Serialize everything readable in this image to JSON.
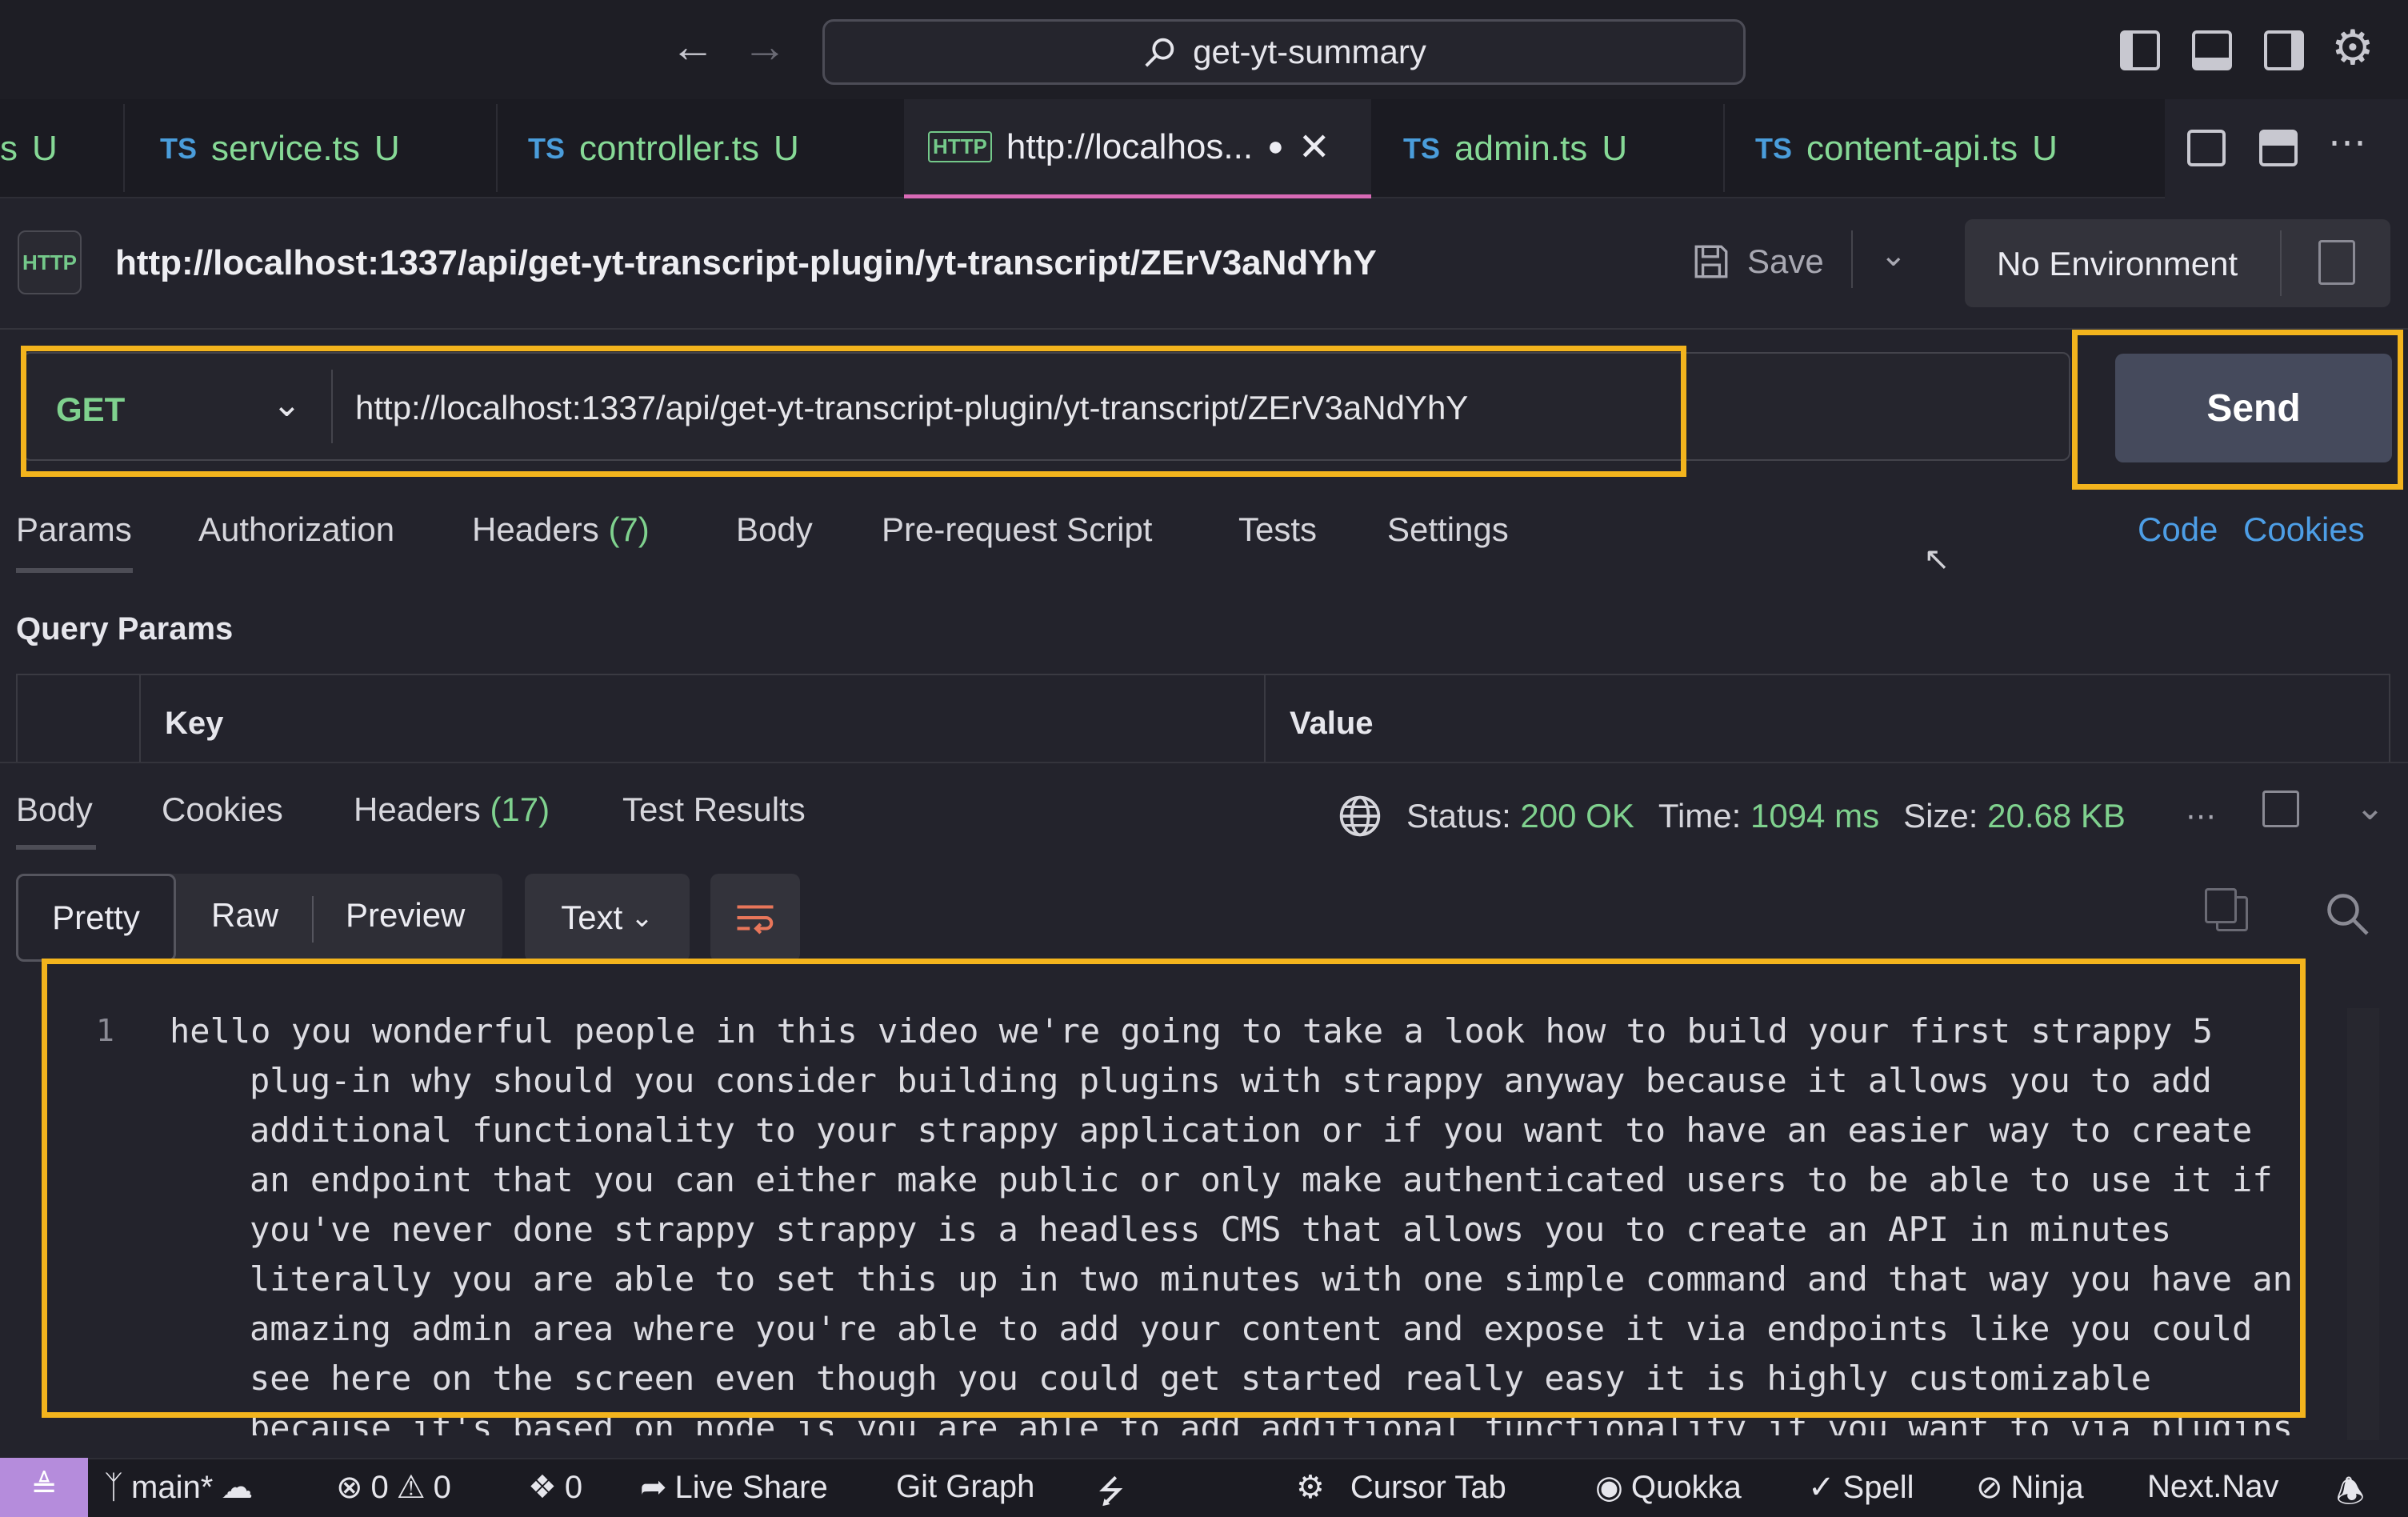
{
  "titlebar": {
    "search_text": "get-yt-summary"
  },
  "tabs": [
    {
      "lang": "",
      "label": "s",
      "status": "U"
    },
    {
      "lang": "TS",
      "label": "service.ts",
      "status": "U"
    },
    {
      "lang": "TS",
      "label": "controller.ts",
      "status": "U"
    },
    {
      "lang": "HTTP",
      "label": "http://localhos...",
      "status": "●"
    },
    {
      "lang": "TS",
      "label": "admin.ts",
      "status": "U"
    },
    {
      "lang": "TS",
      "label": "content-api.ts",
      "status": "U"
    }
  ],
  "request": {
    "badge": "HTTP",
    "title": "http://localhost:1337/api/get-yt-transcript-plugin/yt-transcript/ZErV3aNdYhY",
    "save_label": "Save",
    "environment": "No Environment",
    "method": "GET",
    "url": "http://localhost:1337/api/get-yt-transcript-plugin/yt-transcript/ZErV3aNdYhY",
    "send_label": "Send",
    "tabs": [
      "Params",
      "Authorization",
      "Headers",
      "Body",
      "Pre-request Script",
      "Tests",
      "Settings"
    ],
    "headers_count": "(7)",
    "links": [
      "Code",
      "Cookies"
    ],
    "query_params_title": "Query Params",
    "columns": [
      "Key",
      "Value"
    ]
  },
  "response": {
    "tabs": [
      "Body",
      "Cookies",
      "Headers",
      "Test Results"
    ],
    "headers_count": "(17)",
    "status_label": "Status:",
    "status_value": "200 OK",
    "time_label": "Time:",
    "time_value": "1094 ms",
    "size_label": "Size:",
    "size_value": "20.68 KB",
    "formats": [
      "Pretty",
      "Raw",
      "Preview"
    ],
    "text_mode": "Text",
    "line_number": "1",
    "body": "hello you wonderful people in this video we're going to take a look how to build your first strappy 5 plug-in why should you consider building plugins with strappy anyway because it allows you to add additional functionality to your strappy application or if you want to have an easier way to create an endpoint that you can either make public or only make authenticated users to be able to use it if you've never done strappy strappy is a headless CMS that allows you to create an API in minutes literally you are able to set this up in two minutes with one simple command and that way you have an amazing admin area where you're able to add your content and expose it via endpoints like you could see here on the screen even though you could get started really easy it is highly customizable because it's based on node is you are able to add additional functionality if you want to via plugins and in today's"
  },
  "statusbar": {
    "branch": "main*",
    "errors": "0",
    "warnings": "0",
    "ports": "0",
    "live_share": "Live Share",
    "git_graph": "Git Graph",
    "cursor_tab": "Cursor Tab",
    "quokka": "Quokka",
    "spell": "Spell",
    "ninja": "Ninja",
    "next_nav": "Next.Nav"
  },
  "colors": {
    "accent_highlight": "#f3b41d",
    "method_green": "#7fd18e",
    "link_blue": "#4d9ee6",
    "send_bg": "#454a5c"
  }
}
